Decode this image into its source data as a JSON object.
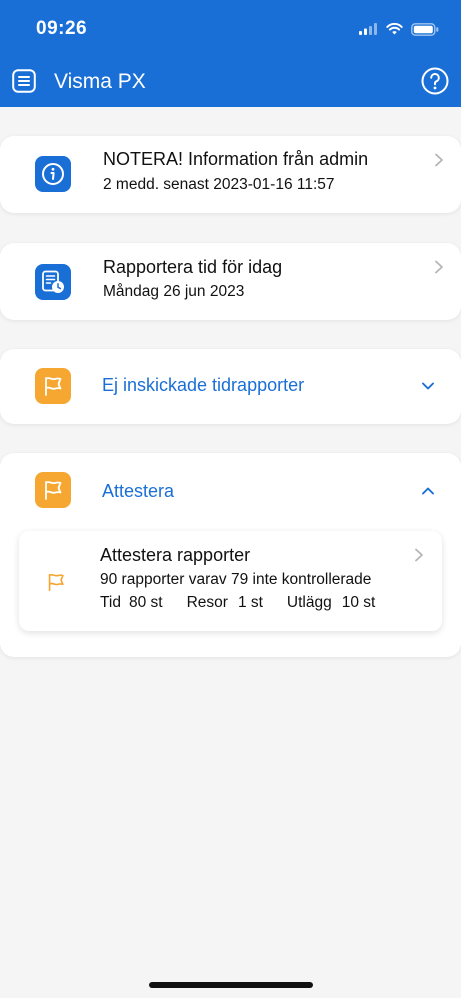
{
  "status_bar": {
    "time": "09:26"
  },
  "header": {
    "title": "Visma PX"
  },
  "colors": {
    "brand_blue": "#1a6fd6",
    "accent_orange": "#f5a732",
    "background": "#f5f5f5"
  },
  "notice_card": {
    "icon": "info-icon",
    "title": "NOTERA!   Information från admin",
    "subtitle": "2 medd.   senast  2023-01-16 11:57"
  },
  "report_time_card": {
    "icon": "timesheet-clock-icon",
    "title": "Rapportera tid för idag",
    "subtitle": "Måndag 26 jun 2023"
  },
  "unsent_section": {
    "icon": "flag-icon",
    "title": "Ej inskickade tidrapporter",
    "state": "collapsed"
  },
  "attest_section": {
    "icon": "flag-icon",
    "title": "Attestera",
    "state": "expanded",
    "item": {
      "icon": "flag-outline-icon",
      "title": "Attestera rapporter",
      "summary": "90 rapporter varav 79 inte kontrollerade",
      "stats": [
        {
          "label": "Tid",
          "value": "80 st"
        },
        {
          "label": "Resor",
          "value": "1 st"
        },
        {
          "label": "Utlägg",
          "value": "10 st"
        }
      ]
    }
  }
}
